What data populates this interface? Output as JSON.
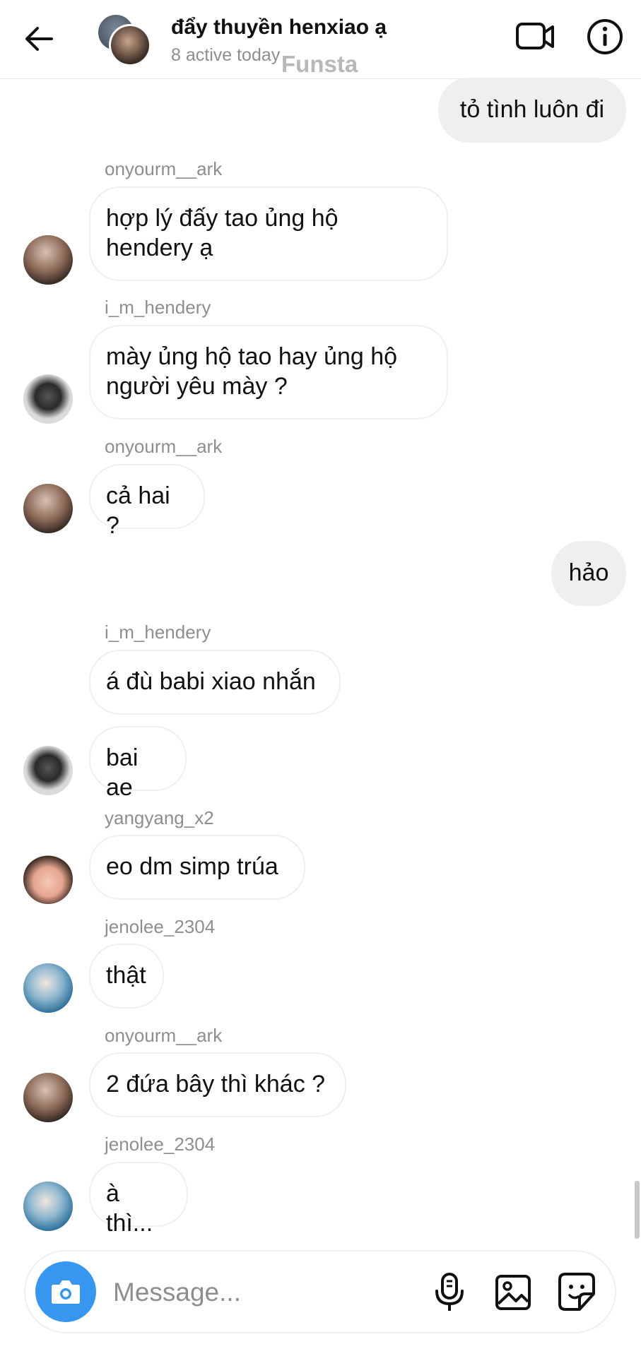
{
  "header": {
    "title": "đẩy thuyền henxiao ạ",
    "subtitle": "8 active today",
    "watermark": "Funsta",
    "icons": {
      "back": "arrow-back-icon",
      "video": "video-call-icon",
      "info": "info-icon"
    }
  },
  "messages": [
    {
      "direction": "out",
      "text": "tỏ tình luôn đi"
    },
    {
      "direction": "in",
      "sender": "onyourm__ark",
      "text_lines": [
        "hợp lý đấy tao ủng hộ",
        "hendery ạ"
      ]
    },
    {
      "direction": "in",
      "sender": "i_m_hendery",
      "text_lines": [
        "mày ủng hộ tao hay ủng hộ",
        "người yêu mày ?"
      ]
    },
    {
      "direction": "in",
      "sender": "onyourm__ark",
      "text": "cả hai ?"
    },
    {
      "direction": "out",
      "text": "hảo"
    },
    {
      "direction": "in",
      "sender": "i_m_hendery",
      "text": "á đù babi xiao nhắn"
    },
    {
      "direction": "in",
      "text": "bai ae"
    },
    {
      "direction": "in",
      "sender": "yangyang_x2",
      "text": "eo dm simp trúa"
    },
    {
      "direction": "in",
      "sender": "jenolee_2304",
      "text": "thật"
    },
    {
      "direction": "in",
      "sender": "onyourm__ark",
      "text": "2 đứa bây thì khác ?"
    },
    {
      "direction": "in",
      "sender": "jenolee_2304",
      "text": "à thì..."
    }
  ],
  "composer": {
    "placeholder": "Message...",
    "value": "",
    "icons": {
      "camera": "camera-icon",
      "mic": "microphone-icon",
      "gallery": "gallery-icon",
      "sticker": "sticker-icon"
    }
  },
  "colors": {
    "accent": "#3797f0",
    "bubble_out": "#efefef",
    "bubble_border": "#efefef",
    "muted_text": "#8e8e8e"
  }
}
